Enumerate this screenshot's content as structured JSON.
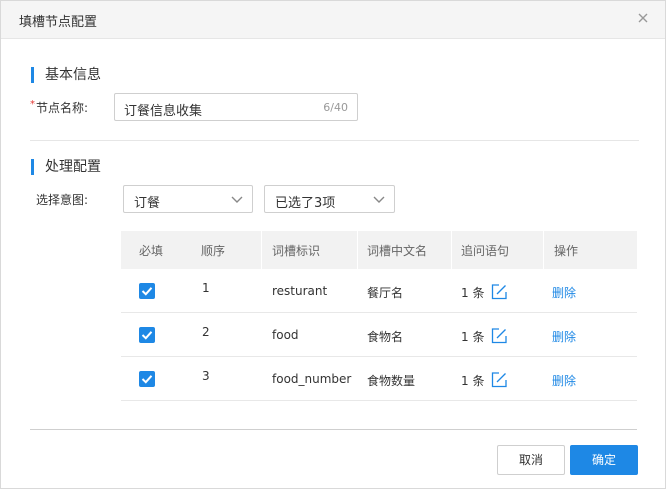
{
  "dialog": {
    "title": "填槽节点配置",
    "close_icon": "close-icon"
  },
  "basic": {
    "section_title": "基本信息",
    "required_mark": "*",
    "name_label": "节点名称:",
    "name_value": "订餐信息收集",
    "name_count": "6/40"
  },
  "processing": {
    "section_title": "处理配置",
    "intent_label": "选择意图:",
    "intent_select": "订餐",
    "slots_select": "已选了3项"
  },
  "table": {
    "headers": [
      "必填",
      "顺序",
      "词槽标识",
      "词槽中文名",
      "追问语句",
      "操作"
    ],
    "rows": [
      {
        "required": true,
        "order": "1",
        "slot_id": "resturant",
        "slot_name": "餐厅名",
        "prompts": "1 条",
        "action": "删除"
      },
      {
        "required": true,
        "order": "2",
        "slot_id": "food",
        "slot_name": "食物名",
        "prompts": "1 条",
        "action": "删除"
      },
      {
        "required": true,
        "order": "3",
        "slot_id": "food_number",
        "slot_name": "食物数量",
        "prompts": "1 条",
        "action": "删除"
      }
    ]
  },
  "footer": {
    "cancel_label": "取消",
    "confirm_label": "确定"
  },
  "colors": {
    "accent": "#1e88e5",
    "required": "#e53935",
    "header_bg": "#f5f5f5",
    "table_header_bg": "#f2f2f2"
  },
  "icons": {
    "checkbox": "checkbox-checked-icon",
    "edit": "edit-icon",
    "dropdown": "chevron-down-icon"
  }
}
